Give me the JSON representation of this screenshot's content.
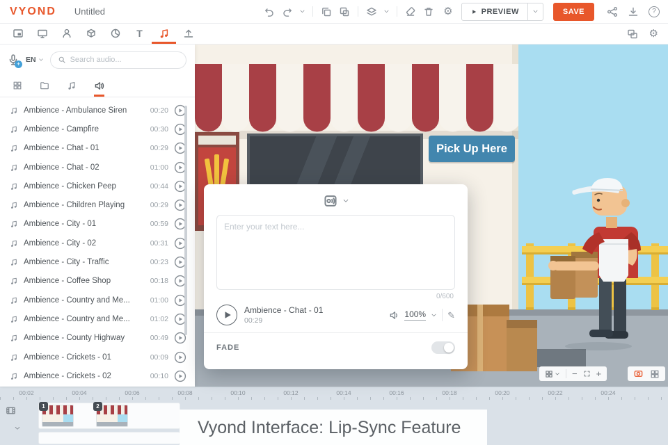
{
  "icons": {
    "gear": "⚙",
    "pencil": "✎",
    "minus": "−",
    "plus": "+",
    "help": "?",
    "add": "+",
    "text_tool": "T"
  },
  "topbar": {
    "logo": "VYOND",
    "title": "Untitled",
    "preview_label": "PREVIEW",
    "save_label": "SAVE"
  },
  "audio_panel": {
    "language": "EN",
    "search_placeholder": "Search audio...",
    "items": [
      {
        "name": "Ambience - Ambulance Siren",
        "duration": "00:20"
      },
      {
        "name": "Ambience - Campfire",
        "duration": "00:30"
      },
      {
        "name": "Ambience - Chat - 01",
        "duration": "00:29"
      },
      {
        "name": "Ambience - Chat - 02",
        "duration": "01:00"
      },
      {
        "name": "Ambience - Chicken Peep",
        "duration": "00:44"
      },
      {
        "name": "Ambience - Children Playing",
        "duration": "00:29"
      },
      {
        "name": "Ambience - City - 01",
        "duration": "00:59"
      },
      {
        "name": "Ambience - City - 02",
        "duration": "00:31"
      },
      {
        "name": "Ambience - City - Traffic",
        "duration": "00:23"
      },
      {
        "name": "Ambience - Coffee Shop",
        "duration": "00:18"
      },
      {
        "name": "Ambience - Country and Me...",
        "duration": "01:00"
      },
      {
        "name": "Ambience - Country and Me...",
        "duration": "01:02"
      },
      {
        "name": "Ambience - County Highway",
        "duration": "00:49"
      },
      {
        "name": "Ambience - Crickets - 01",
        "duration": "00:09"
      },
      {
        "name": "Ambience - Crickets - 02",
        "duration": "00:10"
      }
    ]
  },
  "canvas": {
    "sign_text": "Pick Up Here"
  },
  "modal": {
    "text_placeholder": "Enter your text here...",
    "char_counter": "0/600",
    "track_name": "Ambience - Chat - 01",
    "track_duration": "00:29",
    "volume": "100%",
    "fade_label": "FADE"
  },
  "timeline": {
    "ticks": [
      "00:02",
      "00:04",
      "00:06",
      "00:08",
      "00:10",
      "00:12",
      "00:14",
      "00:16",
      "00:18",
      "00:20",
      "00:22",
      "00:24"
    ],
    "scenes": [
      {
        "number": "1"
      },
      {
        "number": "2"
      }
    ],
    "caption": "Vyond Interface: Lip-Sync Feature"
  }
}
